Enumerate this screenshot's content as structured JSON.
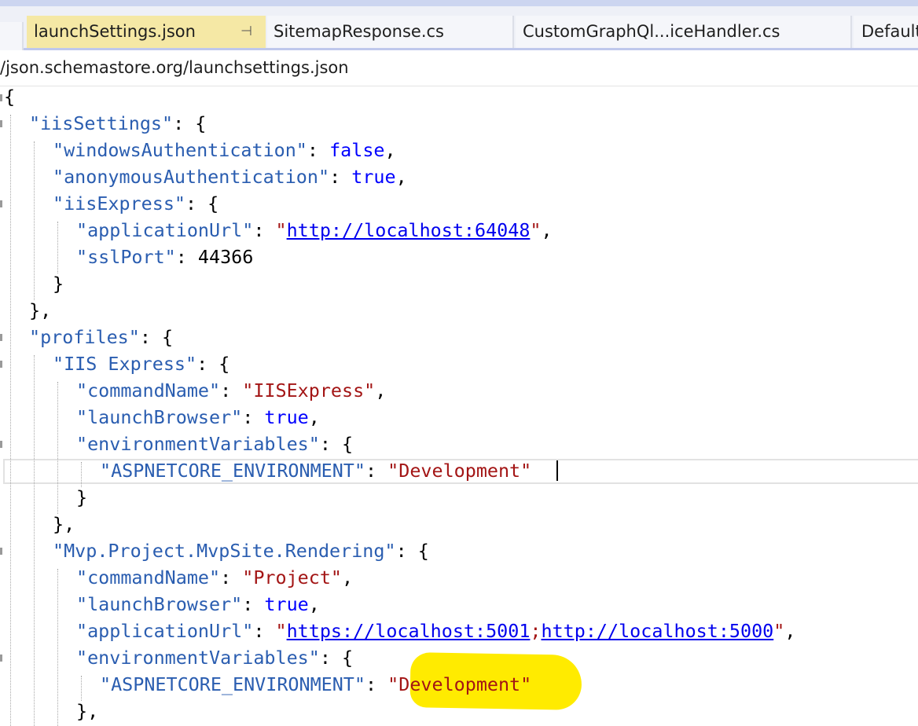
{
  "tabs": [
    {
      "label": "launchSettings.json",
      "active": true,
      "pinned": true
    },
    {
      "label": "SitemapResponse.cs",
      "active": false
    },
    {
      "label": "CustomGraphQl...iceHandler.cs",
      "active": false
    },
    {
      "label": "Default",
      "active": false
    }
  ],
  "navbar": {
    "schema_text": "/json.schemastore.org/launchsettings.json"
  },
  "icons": {
    "pin": "pin-icon",
    "close": "close-icon"
  },
  "colors": {
    "key": "#2a5db0",
    "string": "#a31515",
    "boolean": "#0000ff",
    "link": "#0000ee",
    "highlight": "#ffeb00",
    "active_tab": "#f5e8a5"
  },
  "code": {
    "l1": "{",
    "l2_key": "\"iisSettings\"",
    "l2_rest": ": {",
    "l3_key": "\"windowsAuthentication\"",
    "l3_colon": ": ",
    "l3_val": "false",
    "l3_end": ",",
    "l4_key": "\"anonymousAuthentication\"",
    "l4_colon": ": ",
    "l4_val": "true",
    "l4_end": ",",
    "l5_key": "\"iisExpress\"",
    "l5_rest": ": {",
    "l6_key": "\"applicationUrl\"",
    "l6_colon": ": ",
    "l6_q1": "\"",
    "l6_url": "http://localhost:64048",
    "l6_q2": "\"",
    "l6_end": ",",
    "l7_key": "\"sslPort\"",
    "l7_rest": ": 44366",
    "l8": "}",
    "l9": "},",
    "l10_key": "\"profiles\"",
    "l10_rest": ": {",
    "l11_key": "\"IIS Express\"",
    "l11_rest": ": {",
    "l12_key": "\"commandName\"",
    "l12_colon": ": ",
    "l12_val": "\"IISExpress\"",
    "l12_end": ",",
    "l13_key": "\"launchBrowser\"",
    "l13_colon": ": ",
    "l13_val": "true",
    "l13_end": ",",
    "l14_key": "\"environmentVariables\"",
    "l14_rest": ": {",
    "l15_key": "\"ASPNETCORE_ENVIRONMENT\"",
    "l15_colon": ": ",
    "l15_val": "\"Development\"",
    "l16": "}",
    "l17": "},",
    "l18_key": "\"Mvp.Project.MvpSite.Rendering\"",
    "l18_rest": ": {",
    "l19_key": "\"commandName\"",
    "l19_colon": ": ",
    "l19_val": "\"Project\"",
    "l19_end": ",",
    "l20_key": "\"launchBrowser\"",
    "l20_colon": ": ",
    "l20_val": "true",
    "l20_end": ",",
    "l21_key": "\"applicationUrl\"",
    "l21_colon": ": ",
    "l21_q1": "\"",
    "l21_url1": "https://localhost:5001",
    "l21_sep": ";",
    "l21_url2": "http://localhost:5000",
    "l21_q2": "\"",
    "l21_end": ",",
    "l22_key": "\"environmentVariables\"",
    "l22_rest": ": {",
    "l23_key": "\"ASPNETCORE_ENVIRONMENT\"",
    "l23_colon": ": ",
    "l23_val": "\"Development\"",
    "l24": "},"
  }
}
